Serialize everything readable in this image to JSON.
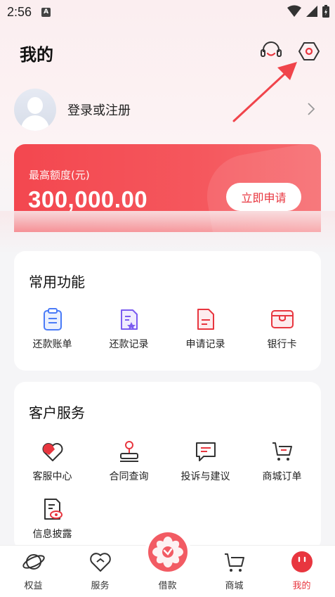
{
  "status_bar": {
    "time": "2:56",
    "notification_letter": "A"
  },
  "header": {
    "title": "我的"
  },
  "profile": {
    "login_text": "登录或注册"
  },
  "quota": {
    "label": "最高额度(元)",
    "amount": "300,000.00",
    "apply_label": "立即申请"
  },
  "common": {
    "title": "常用功能",
    "items": [
      {
        "label": "还款账单",
        "icon": "bill-icon"
      },
      {
        "label": "还款记录",
        "icon": "repay-record-icon"
      },
      {
        "label": "申请记录",
        "icon": "apply-record-icon"
      },
      {
        "label": "银行卡",
        "icon": "bank-card-icon"
      }
    ]
  },
  "service": {
    "title": "客户服务",
    "items": [
      {
        "label": "客服中心",
        "icon": "heart-hand-icon"
      },
      {
        "label": "合同查询",
        "icon": "stamp-icon"
      },
      {
        "label": "投诉与建议",
        "icon": "message-icon"
      },
      {
        "label": "商城订单",
        "icon": "cart-icon"
      },
      {
        "label": "信息披露",
        "icon": "doc-eye-icon"
      }
    ]
  },
  "tabs": [
    {
      "label": "权益",
      "icon": "planet-icon"
    },
    {
      "label": "服务",
      "icon": "heart-icon"
    },
    {
      "label": "借款",
      "icon": "flower-icon"
    },
    {
      "label": "商城",
      "icon": "cart-icon"
    },
    {
      "label": "我的",
      "icon": "face-icon",
      "active": true
    }
  ],
  "colors": {
    "accent": "#e8363f",
    "blue": "#4a7bf7",
    "purple": "#7b5cf0"
  }
}
